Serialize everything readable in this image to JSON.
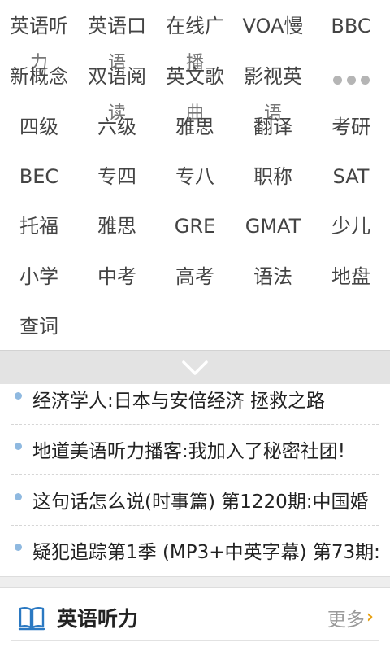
{
  "categories": {
    "row1": [
      "英语听",
      "英语口",
      "在线广",
      "VOA慢",
      "BBC"
    ],
    "row2": [
      "新概念",
      "双语阅",
      "英文歌",
      "影视英"
    ],
    "row2_overflow": [
      "力",
      "语",
      "播",
      ""
    ],
    "row2_hidden": [
      "",
      "读",
      "曲",
      "语"
    ],
    "row3": [
      "四级",
      "六级",
      "雅思",
      "翻译",
      "考研"
    ],
    "row4": [
      "BEC",
      "专四",
      "专八",
      "职称",
      "SAT"
    ],
    "row5": [
      "托福",
      "雅思",
      "GRE",
      "GMAT",
      "少儿"
    ],
    "row6": [
      "小学",
      "中考",
      "高考",
      "语法",
      "地盘"
    ],
    "row7": [
      "查词"
    ],
    "more_icon": "more-dots-icon"
  },
  "collapse": {
    "icon": "chevron-down-icon",
    "color": "#ffffff"
  },
  "news": [
    {
      "title": "经济学人:日本与安倍经济 拯救之路"
    },
    {
      "title": "地道美语听力播客:我加入了秘密社团!"
    },
    {
      "title": "这句话怎么说(时事篇) 第1220期:中国婚"
    },
    {
      "title": "疑犯追踪第1季 (MP3+中英字幕) 第73期:"
    }
  ],
  "section": {
    "icon": "book-icon",
    "title": "英语听力",
    "more_label": "更多",
    "more_arrow": "›"
  },
  "colors": {
    "bullet": "#8fb9e0",
    "accent_arrow": "#e8a317",
    "book_icon": "#2b79c2"
  }
}
